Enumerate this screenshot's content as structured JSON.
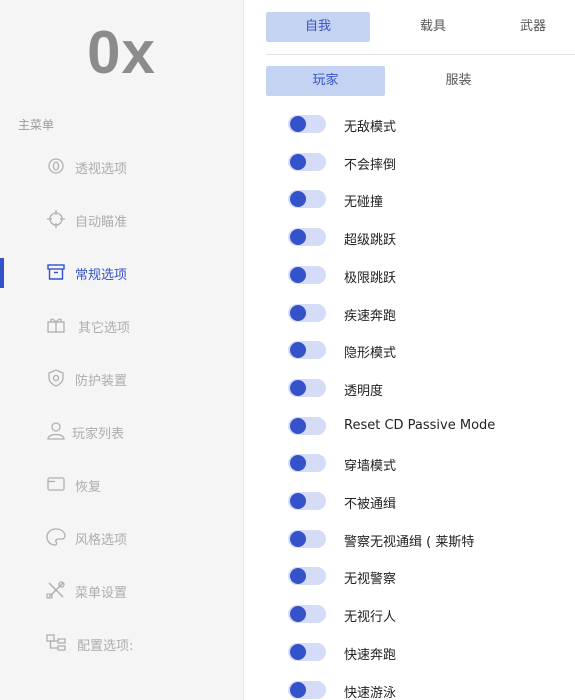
{
  "app": {
    "logo_text": "0x"
  },
  "sidebar": {
    "heading": "主菜单",
    "items": [
      {
        "label": "透视选项",
        "icon": "eye-icon",
        "active": false
      },
      {
        "label": "自动瞄准",
        "icon": "crosshair-icon",
        "active": false
      },
      {
        "label": "常规选项",
        "icon": "archive-box-icon",
        "active": true
      },
      {
        "label": "其它选项",
        "icon": "gift-icon",
        "active": false
      },
      {
        "label": "防护装置",
        "icon": "shield-icon",
        "active": false
      },
      {
        "label": "玩家列表",
        "icon": "user-icon",
        "active": false
      },
      {
        "label": "恢复",
        "icon": "folder-icon",
        "active": false
      },
      {
        "label": "风格选项",
        "icon": "palette-icon",
        "active": false
      },
      {
        "label": "菜单设置",
        "icon": "tools-icon",
        "active": false
      },
      {
        "label": "配置选项:",
        "icon": "tree-icon",
        "active": false
      }
    ]
  },
  "tabs": {
    "primary": [
      {
        "label": "自我",
        "active": true
      },
      {
        "label": "载具",
        "active": false
      },
      {
        "label": "武器",
        "active": false
      }
    ],
    "secondary": [
      {
        "label": "玩家",
        "active": true
      },
      {
        "label": "服装",
        "active": false
      }
    ]
  },
  "options": [
    {
      "label": "无敌模式",
      "enabled": true
    },
    {
      "label": "不会摔倒",
      "enabled": true
    },
    {
      "label": "无碰撞",
      "enabled": true
    },
    {
      "label": "超级跳跃",
      "enabled": true
    },
    {
      "label": "极限跳跃",
      "enabled": true
    },
    {
      "label": "疾速奔跑",
      "enabled": true
    },
    {
      "label": "隐形模式",
      "enabled": true
    },
    {
      "label": "透明度",
      "enabled": true
    },
    {
      "label": "Reset CD Passive Mode",
      "enabled": true
    },
    {
      "label": "穿墙模式",
      "enabled": true
    },
    {
      "label": "不被通缉",
      "enabled": true
    },
    {
      "label": "警察无视通缉 ( 莱斯特",
      "enabled": true
    },
    {
      "label": "无视警察",
      "enabled": true
    },
    {
      "label": "无视行人",
      "enabled": true
    },
    {
      "label": "快速奔跑",
      "enabled": true
    },
    {
      "label": "快速游泳",
      "enabled": true
    }
  ],
  "colors": {
    "accent": "#3452c9",
    "tab_active_bg": "#c5d3f3",
    "toggle_track": "#d5dcf7",
    "sidebar_bg": "#f5f5f5"
  }
}
